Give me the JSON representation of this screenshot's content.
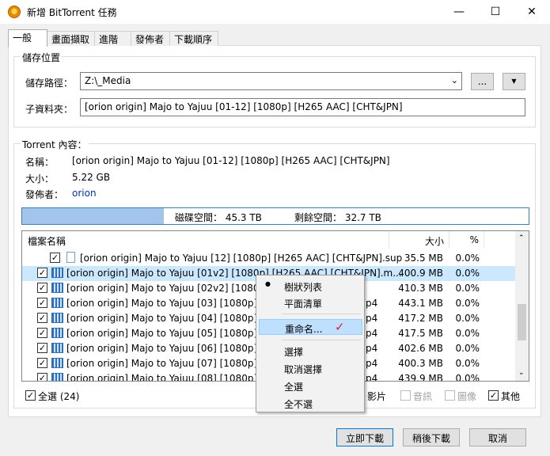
{
  "window": {
    "title": "新增 BitTorrent 任務",
    "minimize": "—",
    "maximize": "☐",
    "close": "✕"
  },
  "tabs": [
    "一般",
    "畫面擷取",
    "進階",
    "發佈者",
    "下載順序"
  ],
  "save_location": {
    "group_title": "儲存位置",
    "path_label": "儲存路徑：",
    "path_value": "Z:\\_Media",
    "browse_label": "...",
    "dropdown_arrow": "▼",
    "subfolder_label": "子資料夾：",
    "subfolder_value": "[orion origin] Majo to Yajuu [01-12] [1080p] [H265 AAC] [CHT&JPN]"
  },
  "torrent": {
    "group_title": "Torrent 內容：",
    "name_label": "名稱：",
    "name_value": "[orion origin] Majo to Yajuu [01-12] [1080p] [H265 AAC] [CHT&JPN]",
    "size_label": "大小：",
    "size_value": "5.22 GB",
    "publisher_label": "發佈者：",
    "publisher_value": "orion",
    "disk_space_text": "磁碟空間： 45.3 TB",
    "free_space_text": "剩餘空間： 32.7 TB",
    "used_fraction": 0.28
  },
  "file_list": {
    "headers": {
      "name": "檔案名稱",
      "size": "大小",
      "pct": "%"
    },
    "rows": [
      {
        "name": "[orion origin] Majo to Yajuu [12] [1080p] [H265 AAC] [CHT&JPN].sup",
        "size": "35.5 MB",
        "pct": "0.0%"
      },
      {
        "name": "[orion origin] Majo to Yajuu [01v2] [1080p] [H265 AAC] [CHT&JPN].m...",
        "size": "400.9 MB",
        "pct": "0.0%"
      },
      {
        "name": "[orion origin] Majo to Yajuu [02v2] [1080p]",
        "size": "410.3 MB",
        "pct": "0.0%"
      },
      {
        "name": "[orion origin] Majo to Yajuu [03] [1080p] [H",
        "tail": "p4",
        "size": "443.1 MB",
        "pct": "0.0%"
      },
      {
        "name": "[orion origin] Majo to Yajuu [04] [1080p] [H",
        "tail": "p4",
        "size": "417.2 MB",
        "pct": "0.0%"
      },
      {
        "name": "[orion origin] Majo to Yajuu [05] [1080p] [H",
        "tail": "p4",
        "size": "417.5 MB",
        "pct": "0.0%"
      },
      {
        "name": "[orion origin] Majo to Yajuu [06] [1080p] [H",
        "tail": "p4",
        "size": "402.6 MB",
        "pct": "0.0%"
      },
      {
        "name": "[orion origin] Majo to Yajuu [07] [1080p] [H",
        "tail": "p4",
        "size": "400.3 MB",
        "pct": "0.0%"
      },
      {
        "name": "[orion origin] Majo to Yajuu [08] [1080p] [H",
        "tail": "p4",
        "size": "439.9 MB",
        "pct": "0.0%"
      }
    ]
  },
  "context_menu": {
    "tree_view": "樹狀列表",
    "flat_list": "平面清單",
    "rename": "重命名...",
    "rename_mark": "✓",
    "select": "選擇",
    "deselect": "取消選擇",
    "select_all": "全選",
    "select_none": "全不選",
    "bullet": "●"
  },
  "filters": {
    "select_all_label": "全選 (24)",
    "video_label": "影片",
    "subtitle_label": "音訊",
    "image_label": "圖像",
    "other_label": "其他"
  },
  "buttons": {
    "download_now": "立即下載",
    "download_later": "稍後下載",
    "cancel": "取消"
  }
}
